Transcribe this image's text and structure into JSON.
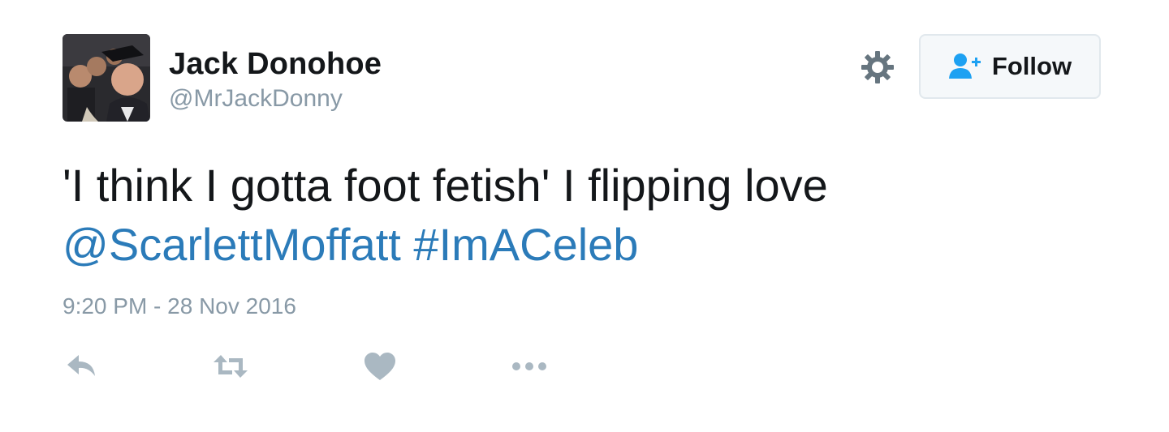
{
  "author": {
    "name": "Jack Donohoe",
    "handle": "@MrJackDonny"
  },
  "follow_button": {
    "label": "Follow",
    "icon": "add-user-icon"
  },
  "settings": {
    "icon": "gear-icon"
  },
  "tweet": {
    "text_line1": "'I think I gotta foot fetish' I flipping love",
    "mention": "@ScarlettMoffatt",
    "hashtag": "#ImACeleb",
    "timestamp": "9:20 PM - 28 Nov 2016"
  },
  "actions": [
    {
      "name": "reply",
      "icon": "reply-icon"
    },
    {
      "name": "retweet",
      "icon": "retweet-icon"
    },
    {
      "name": "like",
      "icon": "heart-icon"
    },
    {
      "name": "more",
      "icon": "more-icon"
    }
  ],
  "colors": {
    "link": "#2b7bb9",
    "muted": "#8899a6",
    "icon": "#aab8c2",
    "text": "#14171a",
    "follow_icon": "#1da1f2"
  }
}
